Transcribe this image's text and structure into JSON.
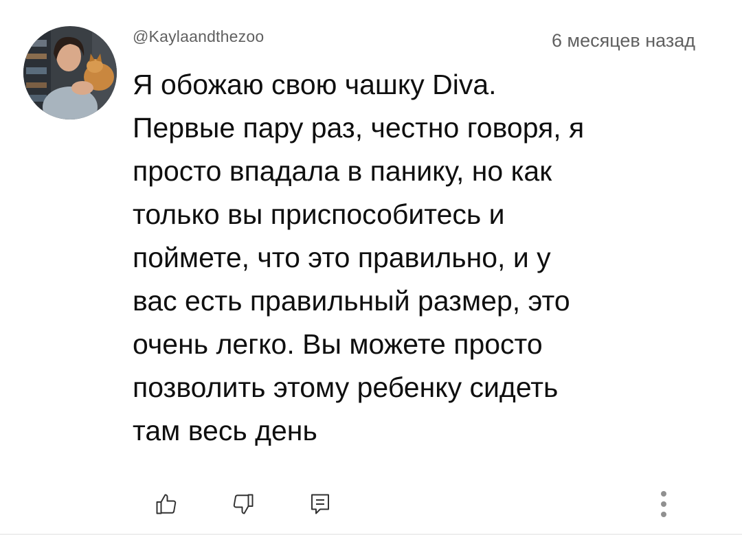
{
  "comment": {
    "author": "@Kaylaandthezoo",
    "timestamp": "6 месяцев назад",
    "text": "Я обожаю свою чашку Diva.\nПервые пару раз, честно говоря, я\nпросто впадала в панику, но как\nтолько вы приспособитесь и\nпоймете, что это правильно, и у\nвас есть правильный размер, это\nочень легко. Вы можете просто\nпозволить этому ребенку сидеть\nтам весь день"
  },
  "actions": {
    "like_icon": "thumbs-up-icon",
    "dislike_icon": "thumbs-down-icon",
    "reply_icon": "reply-comment-icon",
    "menu_icon": "more-vertical-icon"
  },
  "colors": {
    "meta_text": "#606060",
    "body_text": "#0f0f0f",
    "icon": "#303030"
  }
}
